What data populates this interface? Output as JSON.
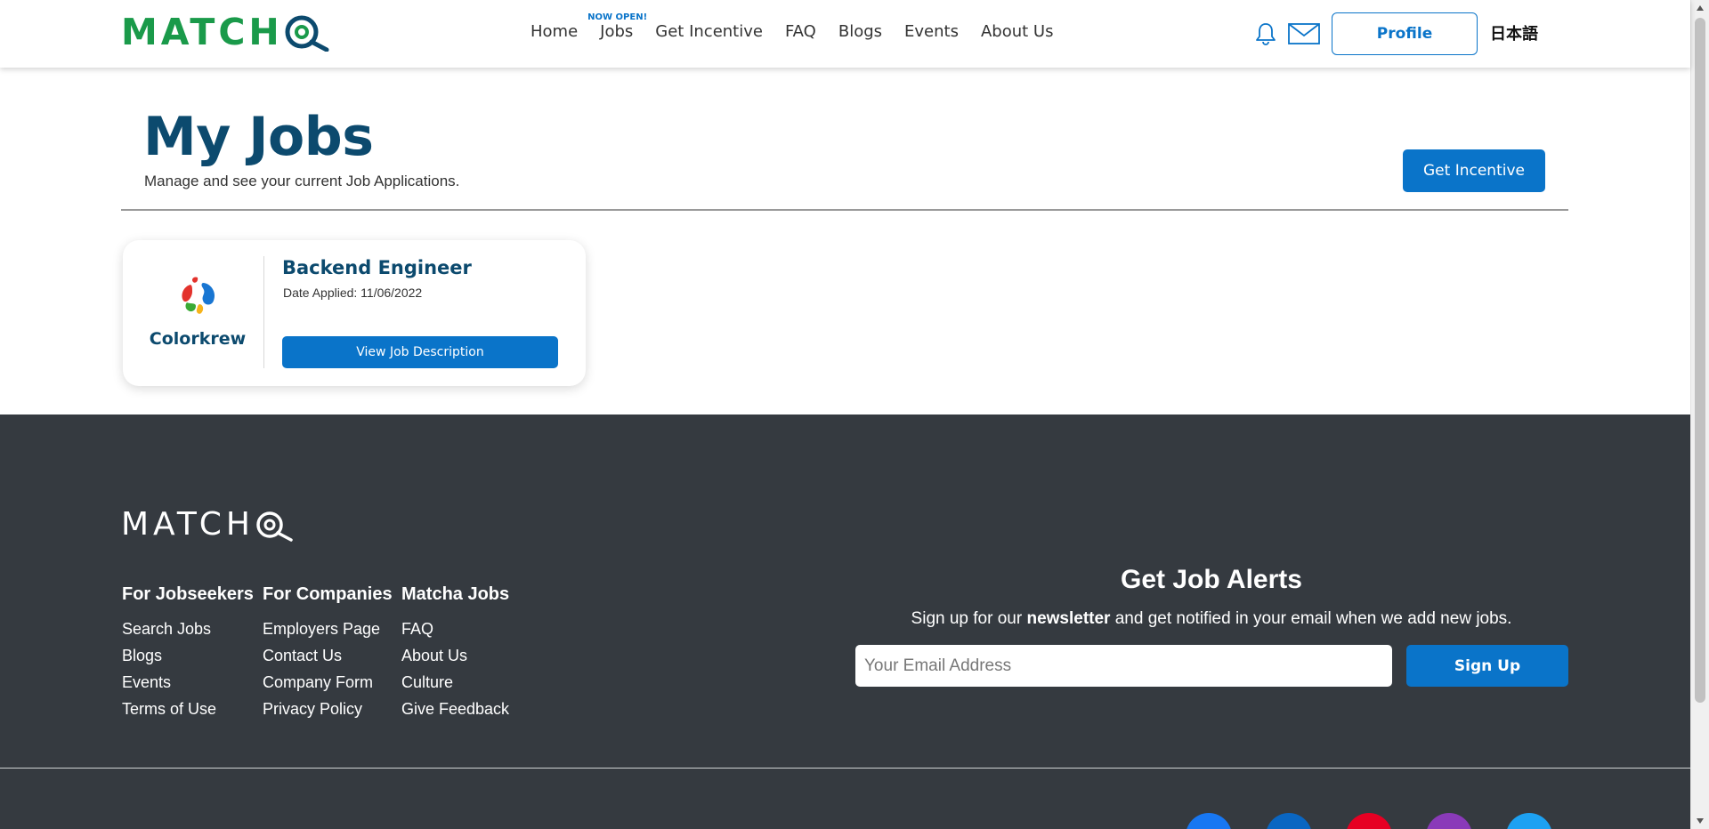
{
  "header": {
    "logo_text": "MATCH",
    "nav": [
      {
        "label": "Home"
      },
      {
        "label": "Jobs",
        "badge": "NOW OPEN!"
      },
      {
        "label": "Get Incentive"
      },
      {
        "label": "FAQ"
      },
      {
        "label": "Blogs"
      },
      {
        "label": "Events"
      },
      {
        "label": "About Us"
      }
    ],
    "bell_icon": "bell-icon",
    "mail_icon": "mail-icon",
    "profile_label": "Profile",
    "language_label": "日本語"
  },
  "main": {
    "title": "My Jobs",
    "subtitle": "Manage and see your current Job Applications.",
    "incentive_button": "Get Incentive",
    "jobs": [
      {
        "company": "Colorkrew",
        "title": "Backend Engineer",
        "date_applied": "Date Applied: 11/06/2022",
        "button_label": "View Job Description"
      }
    ]
  },
  "footer": {
    "logo_text": "MATCH",
    "columns": [
      {
        "title": "For Jobseekers",
        "links": [
          "Search Jobs",
          "Blogs",
          "Events",
          "Terms of Use"
        ]
      },
      {
        "title": "For Companies",
        "links": [
          "Employers Page",
          "Contact Us",
          "Company Form",
          "Privacy Policy"
        ]
      },
      {
        "title": "Matcha Jobs",
        "links": [
          "FAQ",
          "About Us",
          "Culture",
          "Give Feedback"
        ]
      }
    ],
    "alerts": {
      "title": "Get Job Alerts",
      "text_before": "Sign up for our ",
      "text_bold": "newsletter",
      "text_after": " and get notified in your email when we add new jobs.",
      "email_placeholder": "Your Email Address",
      "email_value": "",
      "signup_label": "Sign Up"
    },
    "social": [
      {
        "name": "facebook-icon",
        "color": "#1877f2"
      },
      {
        "name": "linkedin-icon",
        "color": "#0a66c2"
      },
      {
        "name": "youtube-icon",
        "color": "#e60023"
      },
      {
        "name": "instagram-icon",
        "color": "#8a3ab9"
      },
      {
        "name": "twitter-icon",
        "color": "#1da1f2"
      }
    ]
  },
  "colors": {
    "brand_green": "#1a9a4a",
    "brand_navy": "#0c4a6e",
    "accent_blue": "#0a74c9",
    "footer_bg": "#353a40"
  }
}
